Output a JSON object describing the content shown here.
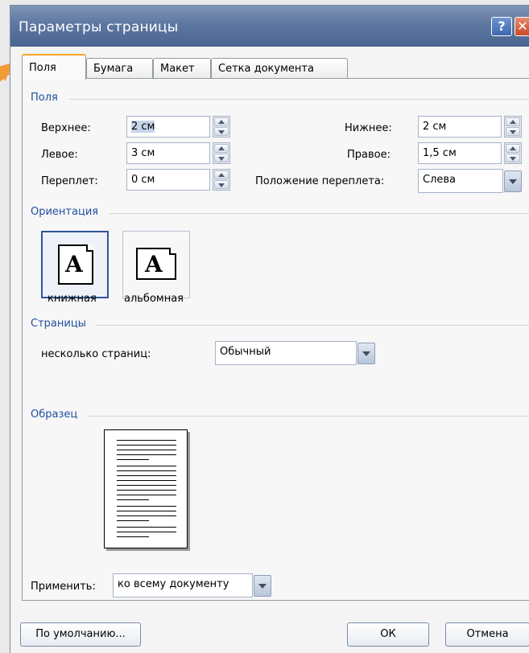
{
  "titlebar": {
    "title": "Параметры страницы",
    "help_label": "?",
    "close_label": "✕"
  },
  "tabs": [
    {
      "label": "Поля",
      "active": true
    },
    {
      "label": "Бумага",
      "active": false
    },
    {
      "label": "Макет",
      "active": false
    },
    {
      "label": "Сетка документа",
      "active": false
    }
  ],
  "margins": {
    "section_label": "Поля",
    "top": {
      "label": "Верхнее:",
      "value": "2 см"
    },
    "bottom": {
      "label": "Нижнее:",
      "value": "2 см"
    },
    "left": {
      "label": "Левое:",
      "value": "3 см"
    },
    "right": {
      "label": "Правое:",
      "value": "1,5 см"
    },
    "gutter": {
      "label": "Переплет:",
      "value": "0 см"
    },
    "gutter_position": {
      "label": "Положение переплета:",
      "value": "Слева"
    }
  },
  "orientation": {
    "section_label": "Ориентация",
    "portrait_label": "книжная",
    "landscape_label": "альбомная",
    "glyph": "A",
    "selected": "portrait"
  },
  "pages": {
    "section_label": "Страницы",
    "multiple_label": "несколько страниц:",
    "multiple_value": "Обычный"
  },
  "preview": {
    "section_label": "Образец"
  },
  "apply": {
    "label": "Применить:",
    "value": "ко всему документу"
  },
  "buttons": {
    "default_label": "По умолчанию...",
    "ok_label": "ОК",
    "cancel_label": "Отмена"
  },
  "colors": {
    "title_bar": "#5d77a0",
    "section_text": "#1f4d9e",
    "active_tab_highlight": "#f5a623",
    "pointer_arrow": "#f29b33"
  }
}
